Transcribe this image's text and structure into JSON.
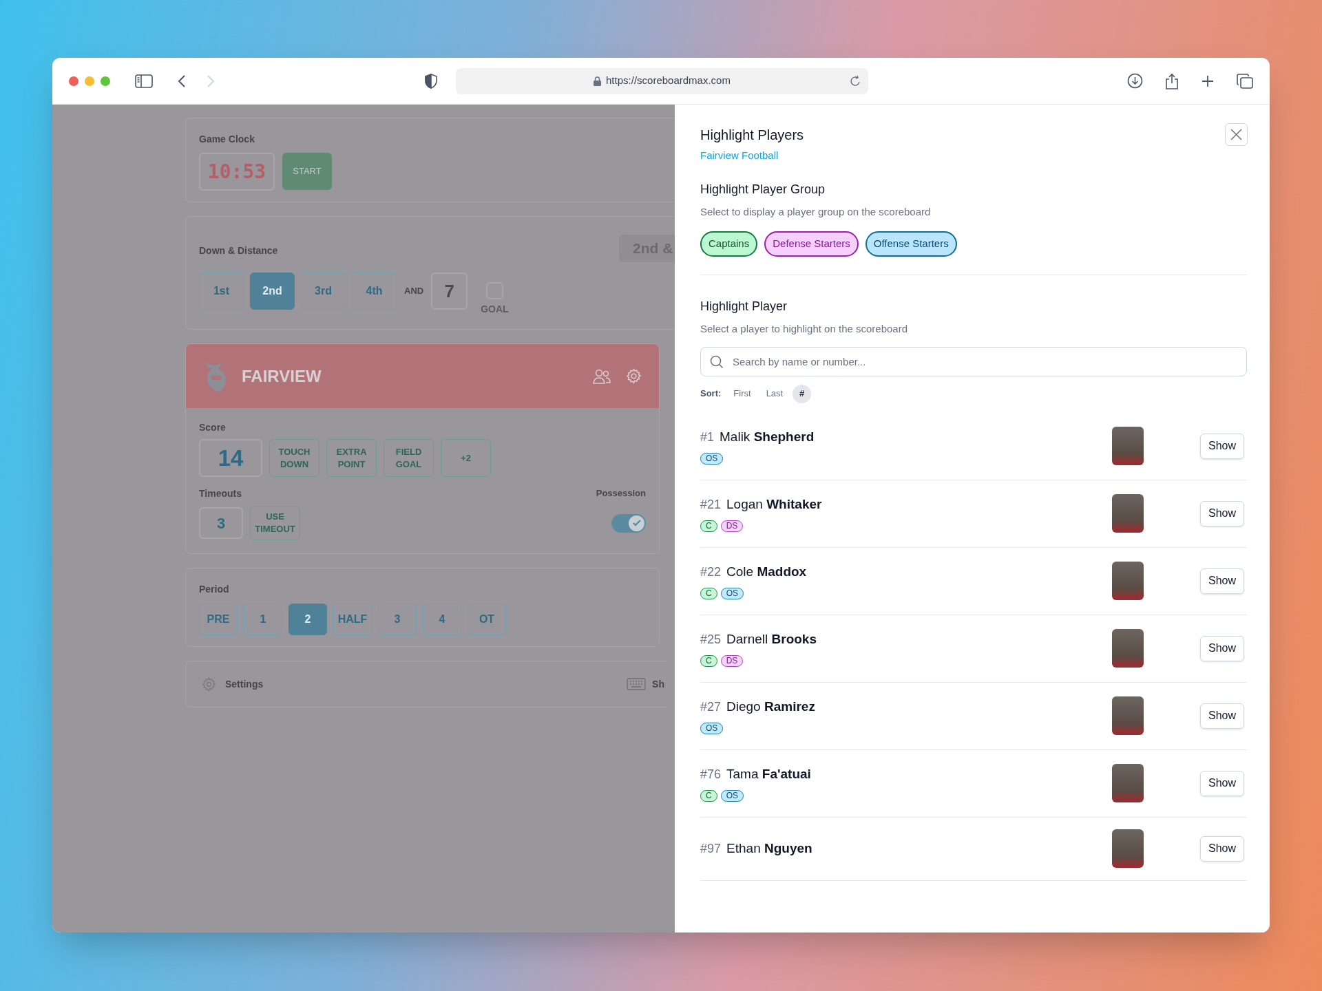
{
  "browser": {
    "url": "https://scoreboardmax.com"
  },
  "game_clock": {
    "label": "Game Clock",
    "time": "10:53",
    "button": "START"
  },
  "down_distance": {
    "label": "Down & Distance",
    "display": "2nd &",
    "downs": [
      {
        "label": "1st",
        "selected": false
      },
      {
        "label": "2nd",
        "selected": true
      },
      {
        "label": "3rd",
        "selected": false
      },
      {
        "label": "4th",
        "selected": false
      }
    ],
    "and_label": "AND",
    "distance": "7",
    "goal": {
      "label": "GOAL",
      "checked": false
    }
  },
  "team": {
    "name": "FAIRVIEW",
    "score_label": "Score",
    "score": "14",
    "score_buttons": [
      "TOUCH DOWN",
      "EXTRA POINT",
      "FIELD GOAL",
      "+2"
    ],
    "timeouts_label": "Timeouts",
    "timeouts": "3",
    "timeout_button": "USE TIMEOUT",
    "possession_label": "Possession",
    "possession": true
  },
  "period": {
    "label": "Period",
    "periods": [
      {
        "label": "PRE",
        "selected": false
      },
      {
        "label": "1",
        "selected": false
      },
      {
        "label": "2",
        "selected": true
      },
      {
        "label": "HALF",
        "selected": false
      },
      {
        "label": "3",
        "selected": false
      },
      {
        "label": "4",
        "selected": false
      },
      {
        "label": "OT",
        "selected": false
      }
    ]
  },
  "footer": {
    "settings": "Settings",
    "shortcuts": "Sh"
  },
  "panel": {
    "title": "Highlight Players",
    "team_link": "Fairview Football",
    "group_section": {
      "title": "Highlight Player Group",
      "description": "Select to display a player group on the scoreboard",
      "groups": [
        {
          "label": "Captains",
          "kind": "captain"
        },
        {
          "label": "Defense Starters",
          "kind": "defense"
        },
        {
          "label": "Offense Starters",
          "kind": "offense"
        }
      ]
    },
    "player_section": {
      "title": "Highlight Player",
      "description": "Select a player to highlight on the scoreboard",
      "search": {
        "placeholder": "Search by name or number..."
      },
      "sort": {
        "label": "Sort:",
        "options": [
          {
            "label": "First",
            "selected": false
          },
          {
            "label": "Last",
            "selected": false
          },
          {
            "label": "#",
            "selected": true
          }
        ]
      },
      "players": [
        {
          "number": "#1",
          "name": "Malik **Shepherd**",
          "tags": [
            {
              "label": "OS",
              "kind": "offense"
            }
          ],
          "button": "Show"
        },
        {
          "number": "#21",
          "name": "Logan **Whitaker**",
          "tags": [
            {
              "label": "C",
              "kind": "captain"
            },
            {
              "label": "DS",
              "kind": "defense"
            }
          ],
          "button": "Show"
        },
        {
          "number": "#22",
          "name": "Cole **Maddox**",
          "tags": [
            {
              "label": "C",
              "kind": "captain"
            },
            {
              "label": "OS",
              "kind": "offense"
            }
          ],
          "button": "Show"
        },
        {
          "number": "#25",
          "name": "Darnell **Brooks**",
          "tags": [
            {
              "label": "C",
              "kind": "captain"
            },
            {
              "label": "DS",
              "kind": "defense"
            }
          ],
          "button": "Show"
        },
        {
          "number": "#27",
          "name": "Diego **Ramirez**",
          "tags": [
            {
              "label": "OS",
              "kind": "offense"
            }
          ],
          "button": "Show"
        },
        {
          "number": "#76",
          "name": "Tama **Fa'atuai**",
          "tags": [
            {
              "label": "C",
              "kind": "captain"
            },
            {
              "label": "OS",
              "kind": "offense"
            }
          ],
          "button": "Show"
        },
        {
          "number": "#97",
          "name": "Ethan **Nguyen**",
          "button": "Show"
        }
      ]
    }
  }
}
